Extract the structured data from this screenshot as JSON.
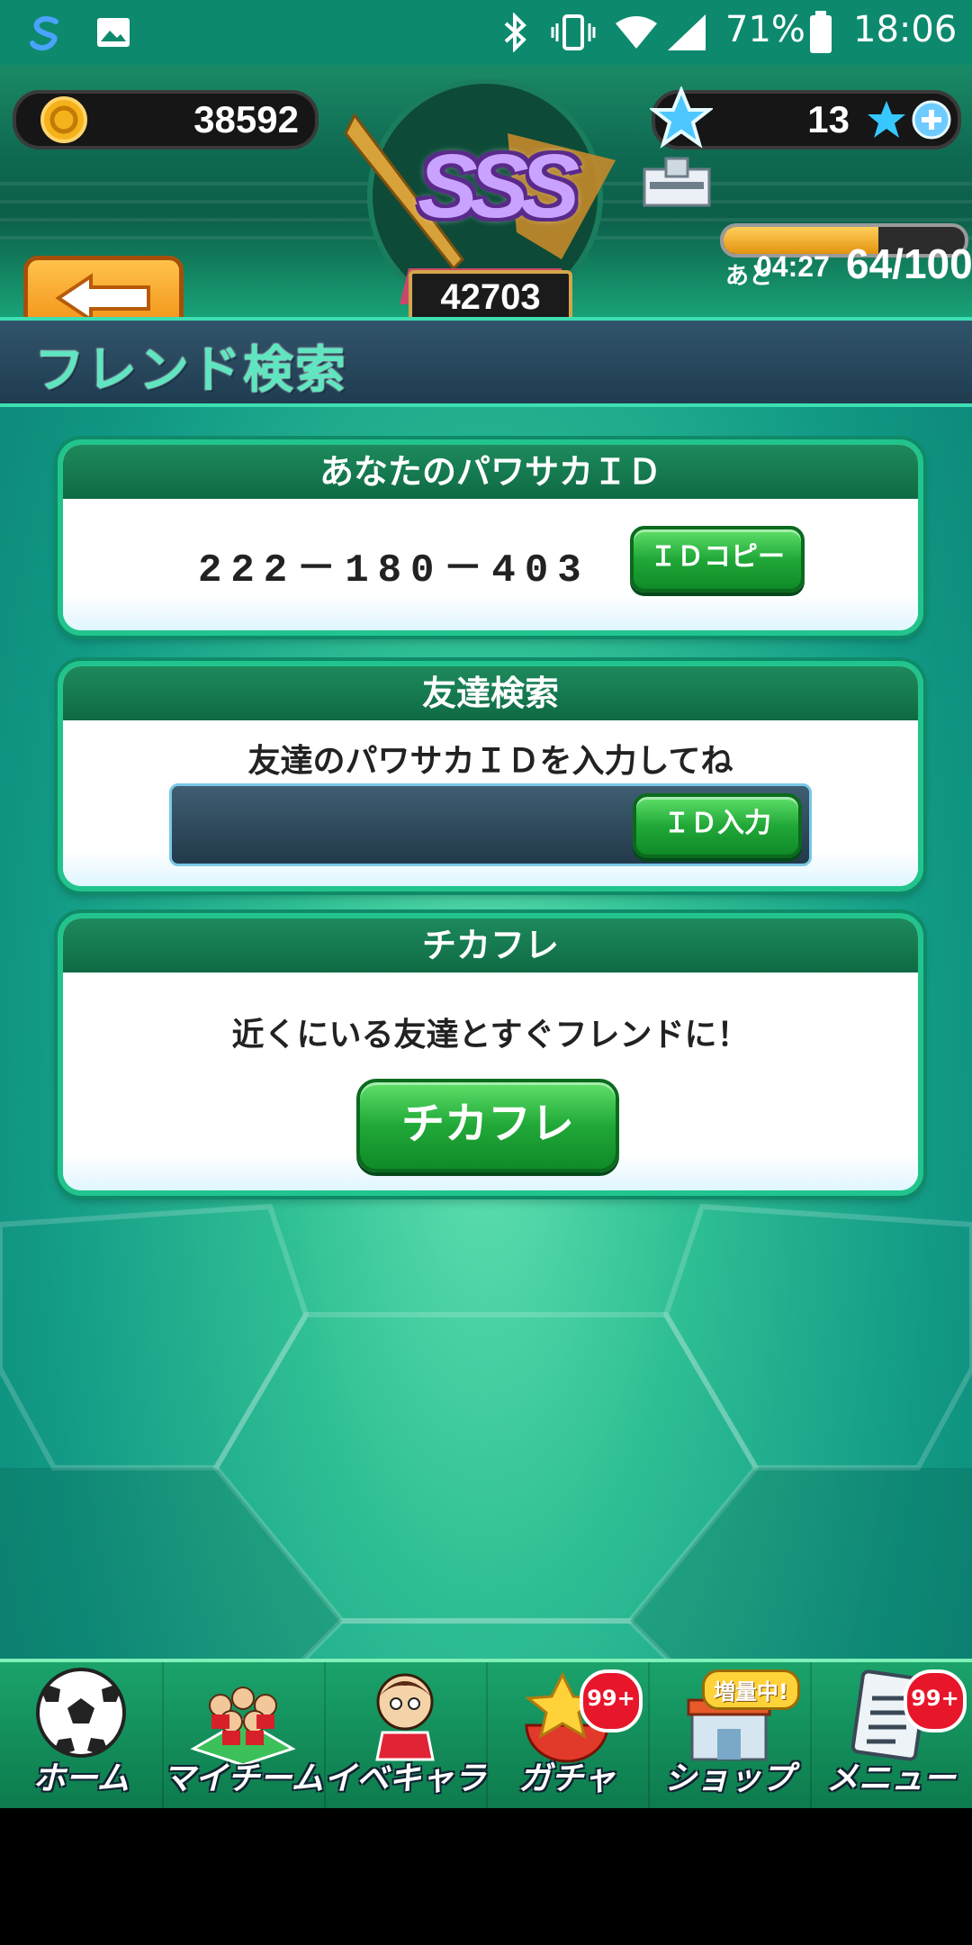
{
  "status_bar": {
    "battery": "71%",
    "time": "18:06"
  },
  "hud": {
    "coins": "38592",
    "rank": "SSS",
    "team_power": "42703",
    "stars": "13",
    "stamina_timer_prefix": "あと",
    "stamina_timer": "04:27",
    "stamina": "64/100",
    "stamina_fraction": 0.64
  },
  "page": {
    "title": "フレンド検索"
  },
  "my_id_panel": {
    "heading": "あなたのパワサカＩＤ",
    "id_value": "222－180－403",
    "copy_button": "ＩＤコピー"
  },
  "friend_search_panel": {
    "heading": "友達検索",
    "instruction": "友達のパワサカＩＤを入力してね",
    "input_value": "",
    "input_button": "ＩＤ入力"
  },
  "chikafure_panel": {
    "heading": "チカフレ",
    "description": "近くにいる友達とすぐフレンドに！",
    "button": "チカフレ"
  },
  "bottom_nav": {
    "items": [
      {
        "label": "ホーム",
        "icon": "soccer-ball-icon",
        "badge": ""
      },
      {
        "label": "マイチーム",
        "icon": "team-icon",
        "badge": ""
      },
      {
        "label": "イベキャラ",
        "icon": "event-character-icon",
        "badge": ""
      },
      {
        "label": "ガチャ",
        "icon": "gacha-icon",
        "badge": "99+"
      },
      {
        "label": "ショップ",
        "icon": "shop-icon",
        "badge": "",
        "tag": "増量中!"
      },
      {
        "label": "メニュー",
        "icon": "menu-icon",
        "badge": "99+"
      }
    ]
  },
  "colors": {
    "accent": "#22c48e",
    "button_green": "#21a838",
    "back_orange": "#f08a10",
    "badge_red": "#e8162a"
  }
}
